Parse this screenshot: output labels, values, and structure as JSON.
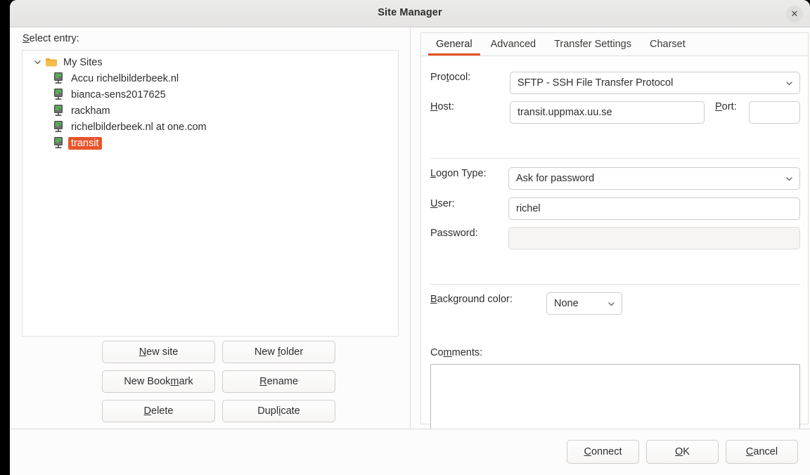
{
  "window": {
    "title": "Site Manager",
    "close_icon": "close-icon"
  },
  "left_pane": {
    "select_entry_label": "Select entry:",
    "tree": {
      "root": {
        "label": "My Sites",
        "icon": "folder-icon",
        "expander_icon": "chevron-down-icon",
        "expanded": true
      },
      "items": [
        {
          "label": "Accu richelbilderbeek.nl",
          "icon": "server-icon",
          "selected": false
        },
        {
          "label": "bianca-sens2017625",
          "icon": "server-icon",
          "selected": false
        },
        {
          "label": "rackham",
          "icon": "server-icon",
          "selected": false
        },
        {
          "label": "richelbilderbeek.nl at one.com",
          "icon": "server-icon",
          "selected": false
        },
        {
          "label": "transit",
          "icon": "server-icon",
          "selected": true
        }
      ]
    },
    "buttons": [
      {
        "label": "New site",
        "mnemonic": "N"
      },
      {
        "label": "New folder",
        "mnemonic": "f"
      },
      {
        "label": "New Bookmark",
        "mnemonic": "m"
      },
      {
        "label": "Rename",
        "mnemonic": "R"
      },
      {
        "label": "Delete",
        "mnemonic": "D"
      },
      {
        "label": "Duplicate",
        "mnemonic": "i"
      }
    ]
  },
  "right_pane": {
    "tabs": [
      {
        "label": "General",
        "active": true
      },
      {
        "label": "Advanced",
        "active": false
      },
      {
        "label": "Transfer Settings",
        "active": false
      },
      {
        "label": "Charset",
        "active": false
      }
    ],
    "general": {
      "protocol": {
        "label": "Protocol:",
        "mnemonic": "t",
        "value": "SFTP - SSH File Transfer Protocol",
        "chevron_icon": "chevron-down-icon"
      },
      "host": {
        "label": "Host:",
        "mnemonic": "H",
        "value": "transit.uppmax.uu.se",
        "placeholder": ""
      },
      "port": {
        "label": "Port:",
        "mnemonic": "P",
        "value": "",
        "placeholder": ""
      },
      "logon_type": {
        "label": "Logon Type:",
        "mnemonic": "L",
        "value": "Ask for password",
        "chevron_icon": "chevron-down-icon"
      },
      "user": {
        "label": "User:",
        "mnemonic": "U",
        "value": "richel",
        "placeholder": ""
      },
      "password": {
        "label": "Password:",
        "value": "",
        "placeholder": "",
        "disabled": true
      },
      "background_color": {
        "label": "Background color:",
        "mnemonic": "B",
        "value": "None",
        "chevron_icon": "chevron-down-icon"
      },
      "comments": {
        "label": "Comments:",
        "mnemonic": "m",
        "value": "",
        "placeholder": ""
      }
    }
  },
  "footer": {
    "buttons": [
      {
        "label": "Connect",
        "mnemonic": "C"
      },
      {
        "label": "OK",
        "mnemonic": "O"
      },
      {
        "label": "Cancel",
        "mnemonic": "C"
      }
    ]
  },
  "colors": {
    "accent": "#e8521f",
    "selection": "#e8552b",
    "folder": "#f0ab32",
    "window_bg": "#fcfcfc",
    "titlebar_bg": "#e9e8e7"
  }
}
